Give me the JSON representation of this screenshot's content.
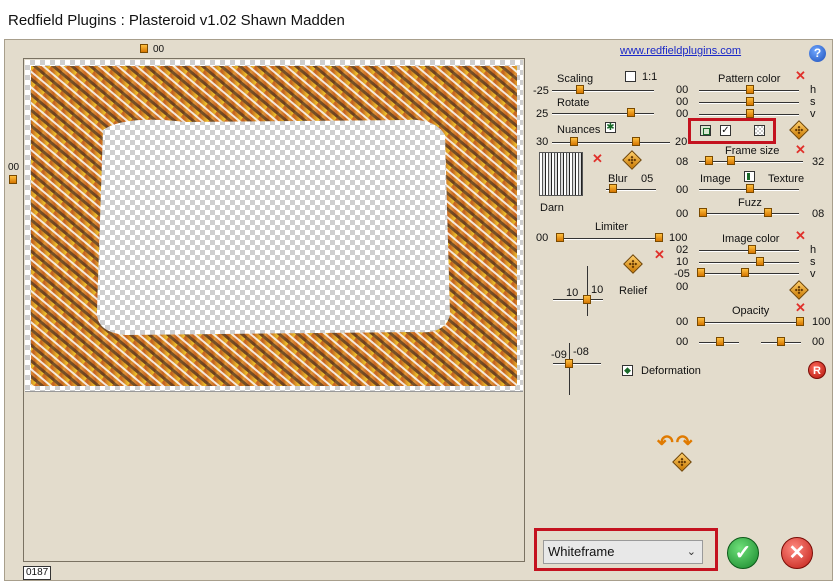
{
  "window": {
    "title": "Redfield Plugins : Plasteroid v1.02   Shawn Madden"
  },
  "header": {
    "link_text": "www.redfieldplugins.com",
    "help_label": "?"
  },
  "preview": {
    "top_value": "00",
    "left_value": "00",
    "counter": "0187"
  },
  "left_column": {
    "scaling": {
      "label": "Scaling",
      "value": "-25"
    },
    "one_to_one": {
      "label": "1:1"
    },
    "rotate": {
      "label": "Rotate",
      "value": "25"
    },
    "nuances": {
      "label": "Nuances",
      "left_value": "30",
      "right_value": "20"
    },
    "texture_name": "Darn",
    "blur": {
      "label": "Blur",
      "value": "05"
    },
    "limiter": {
      "label": "Limiter",
      "left_value": "00",
      "right_value": "100"
    },
    "relief": {
      "label": "Relief",
      "x_value": "10",
      "y_value": "10"
    },
    "deformation_point": {
      "x_value": "-09",
      "y_value": "-08"
    },
    "deformation": {
      "label": "Deformation"
    }
  },
  "right_column": {
    "pattern_color": {
      "label": "Pattern color",
      "h": "00",
      "s": "00",
      "v": "00",
      "h_label": "h",
      "s_label": "s",
      "v_label": "v"
    },
    "frame_size": {
      "label": "Frame size",
      "min": "08",
      "max": "32"
    },
    "image_texture": {
      "image_label": "Image",
      "texture_label": "Texture",
      "value": "00"
    },
    "fuzz": {
      "label": "Fuzz",
      "min": "00",
      "max": "08"
    },
    "image_color": {
      "label": "Image color",
      "h": "02",
      "s": "10",
      "v": "-05",
      "extra": "00",
      "h_label": "h",
      "s_label": "s",
      "v_label": "v"
    },
    "opacity": {
      "label": "Opacity",
      "min": "00",
      "max": "100",
      "row2_left": "00",
      "row2_right": "00"
    },
    "reset_label": "R"
  },
  "footer": {
    "preset_selected": "Whiteframe",
    "ok": "✓",
    "cancel": "✕"
  },
  "colors": {
    "panel": "#e3dccc",
    "knob": "#e88a10",
    "highlight": "#c4121f",
    "link": "#1a28c8"
  }
}
